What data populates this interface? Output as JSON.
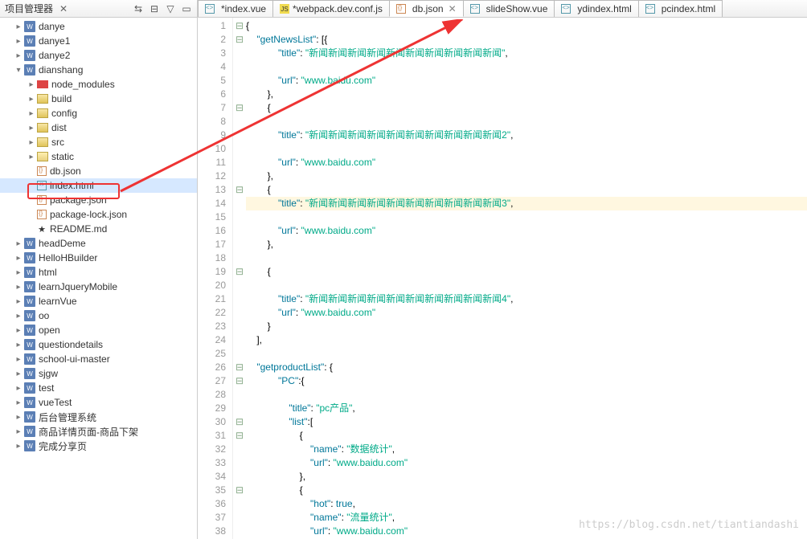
{
  "sidebar": {
    "title": "项目管理器",
    "items": [
      {
        "d": 0,
        "tw": "▸",
        "icon": "w",
        "label": "danye"
      },
      {
        "d": 0,
        "tw": "▸",
        "icon": "w",
        "label": "danye1"
      },
      {
        "d": 0,
        "tw": "▸",
        "icon": "w",
        "label": "danye2"
      },
      {
        "d": 0,
        "tw": "▾",
        "icon": "w",
        "label": "dianshang"
      },
      {
        "d": 1,
        "tw": "▸",
        "icon": "nm",
        "label": "node_modules"
      },
      {
        "d": 1,
        "tw": "▸",
        "icon": "fld",
        "label": "build"
      },
      {
        "d": 1,
        "tw": "▸",
        "icon": "fld",
        "label": "config"
      },
      {
        "d": 1,
        "tw": "▸",
        "icon": "fld",
        "label": "dist"
      },
      {
        "d": 1,
        "tw": "▸",
        "icon": "fld",
        "label": "src"
      },
      {
        "d": 1,
        "tw": "▸",
        "icon": "fldo",
        "label": "static"
      },
      {
        "d": 1,
        "tw": " ",
        "icon": "jsn",
        "label": "db.json",
        "red": true
      },
      {
        "d": 1,
        "tw": " ",
        "icon": "htm",
        "label": "index.html",
        "sel": true
      },
      {
        "d": 1,
        "tw": " ",
        "icon": "jsn",
        "label": "package.json"
      },
      {
        "d": 1,
        "tw": " ",
        "icon": "jsn",
        "label": "package-lock.json"
      },
      {
        "d": 1,
        "tw": " ",
        "icon": "star",
        "label": "README.md"
      },
      {
        "d": 0,
        "tw": "▸",
        "icon": "w",
        "label": "headDeme"
      },
      {
        "d": 0,
        "tw": "▸",
        "icon": "w",
        "label": "HelloHBuilder"
      },
      {
        "d": 0,
        "tw": "▸",
        "icon": "w",
        "label": "html"
      },
      {
        "d": 0,
        "tw": "▸",
        "icon": "w",
        "label": "learnJqueryMobile"
      },
      {
        "d": 0,
        "tw": "▸",
        "icon": "w",
        "label": "learnVue"
      },
      {
        "d": 0,
        "tw": "▸",
        "icon": "w",
        "label": "oo"
      },
      {
        "d": 0,
        "tw": "▸",
        "icon": "w",
        "label": "open"
      },
      {
        "d": 0,
        "tw": "▸",
        "icon": "w",
        "label": "questiondetails"
      },
      {
        "d": 0,
        "tw": "▸",
        "icon": "w",
        "label": "school-ui-master"
      },
      {
        "d": 0,
        "tw": "▸",
        "icon": "w",
        "label": "sjgw"
      },
      {
        "d": 0,
        "tw": "▸",
        "icon": "w",
        "label": "test"
      },
      {
        "d": 0,
        "tw": "▸",
        "icon": "w",
        "label": "vueTest"
      },
      {
        "d": 0,
        "tw": "▸",
        "icon": "w",
        "label": "后台管理系统"
      },
      {
        "d": 0,
        "tw": "▸",
        "icon": "w",
        "label": "商品详情页面-商品下架"
      },
      {
        "d": 0,
        "tw": "▸",
        "icon": "w",
        "label": "完成分享页"
      }
    ]
  },
  "tabs": [
    {
      "icon": "htm",
      "label": "*index.vue"
    },
    {
      "icon": "js",
      "label": "*webpack.dev.conf.js"
    },
    {
      "icon": "jsn",
      "label": "db.json",
      "active": true,
      "close": true
    },
    {
      "icon": "htm",
      "label": "slideShow.vue"
    },
    {
      "icon": "htm",
      "label": "ydindex.html"
    },
    {
      "icon": "htm",
      "label": "pcindex.html"
    }
  ],
  "code": [
    {
      "n": 1,
      "f": "⊟",
      "t": "{"
    },
    {
      "n": 2,
      "f": "⊟",
      "t": "    \"getNewsList\": [{"
    },
    {
      "n": 3,
      "f": "",
      "t": "            \"title\": \"新闻新闻新闻新闻新闻新闻新闻新闻新闻新闻\","
    },
    {
      "n": 4,
      "f": "",
      "t": ""
    },
    {
      "n": 5,
      "f": "",
      "t": "            \"url\": \"www.baidu.com\""
    },
    {
      "n": 6,
      "f": "",
      "t": "        },"
    },
    {
      "n": 7,
      "f": "⊟",
      "t": "        {"
    },
    {
      "n": 8,
      "f": "",
      "t": ""
    },
    {
      "n": 9,
      "f": "",
      "t": "            \"title\": \"新闻新闻新闻新闻新闻新闻新闻新闻新闻新闻2\","
    },
    {
      "n": 10,
      "f": "",
      "t": ""
    },
    {
      "n": 11,
      "f": "",
      "t": "            \"url\": \"www.baidu.com\""
    },
    {
      "n": 12,
      "f": "",
      "t": "        },"
    },
    {
      "n": 13,
      "f": "⊟",
      "t": "        {"
    },
    {
      "n": 14,
      "f": "",
      "t": "            \"title\": \"新闻新闻新闻新闻新闻新闻新闻新闻新闻新闻3\",",
      "hl": true
    },
    {
      "n": 15,
      "f": "",
      "t": ""
    },
    {
      "n": 16,
      "f": "",
      "t": "            \"url\":\"www.baidu.com\""
    },
    {
      "n": 17,
      "f": "",
      "t": "        },"
    },
    {
      "n": 18,
      "f": "",
      "t": ""
    },
    {
      "n": 19,
      "f": "⊟",
      "t": "        {"
    },
    {
      "n": 20,
      "f": "",
      "t": ""
    },
    {
      "n": 21,
      "f": "",
      "t": "            \"title\": \"新闻新闻新闻新闻新闻新闻新闻新闻新闻新闻4\","
    },
    {
      "n": 22,
      "f": "",
      "t": "            \"url\": \"www.baidu.com\""
    },
    {
      "n": 23,
      "f": "",
      "t": "        }"
    },
    {
      "n": 24,
      "f": "",
      "t": "    ],"
    },
    {
      "n": 25,
      "f": "",
      "t": ""
    },
    {
      "n": 26,
      "f": "⊟",
      "t": "    \"getproductList\": {"
    },
    {
      "n": 27,
      "f": "⊟",
      "t": "            \"PC\":{"
    },
    {
      "n": 28,
      "f": "",
      "t": ""
    },
    {
      "n": 29,
      "f": "",
      "t": "                \"title\":\"pc产品\","
    },
    {
      "n": 30,
      "f": "⊟",
      "t": "                \"list\":["
    },
    {
      "n": 31,
      "f": "⊟",
      "t": "                    {"
    },
    {
      "n": 32,
      "f": "",
      "t": "                        \"name\":\"数据统计\","
    },
    {
      "n": 33,
      "f": "",
      "t": "                        \"url\":\"www.baidu.com\""
    },
    {
      "n": 34,
      "f": "",
      "t": "                    },"
    },
    {
      "n": 35,
      "f": "⊟",
      "t": "                    {"
    },
    {
      "n": 36,
      "f": "",
      "t": "                        \"hot\":true,"
    },
    {
      "n": 37,
      "f": "",
      "t": "                        \"name\":\"流量统计\","
    },
    {
      "n": 38,
      "f": "",
      "t": "                        \"url\":\"www.baidu.com\""
    }
  ],
  "watermark": "https://blog.csdn.net/tiantiandashi"
}
